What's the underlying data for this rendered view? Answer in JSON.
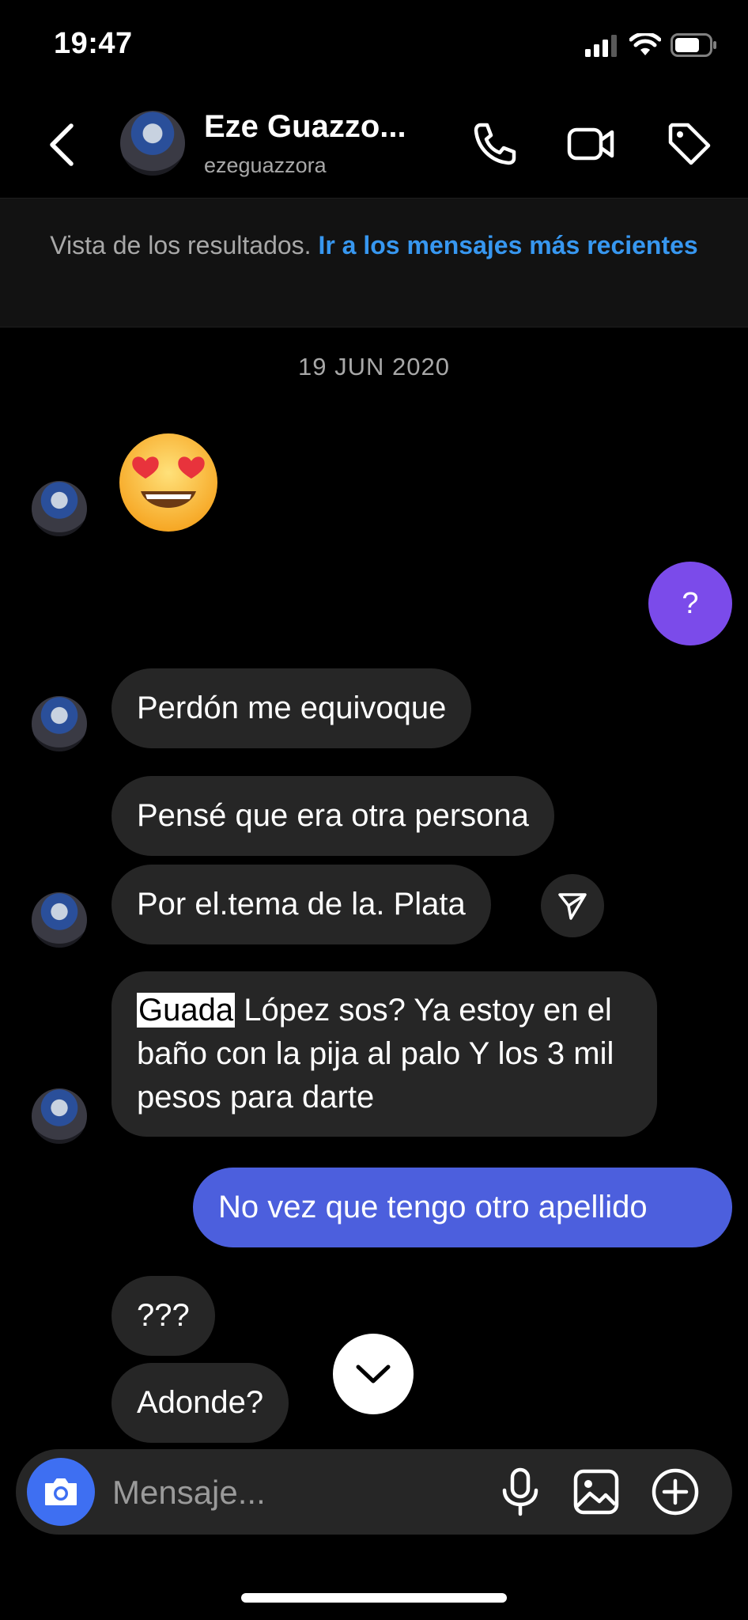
{
  "status_bar": {
    "time": "19:47"
  },
  "header": {
    "name": "Eze Guazzo...",
    "username": "ezeguazzora",
    "icons": [
      "back-chevron-icon",
      "phone-icon",
      "video-icon",
      "tag-icon"
    ]
  },
  "banner": {
    "text": "Vista de los resultados.",
    "link": "Ir a los mensajes más recientes"
  },
  "date_divider": "19 JUN 2020",
  "messages": [
    {
      "from": "them",
      "type": "emoji",
      "content": "heart-eyes"
    },
    {
      "from": "me",
      "text": "?"
    },
    {
      "from": "them",
      "text": "Perdón me equivoque"
    },
    {
      "from": "them",
      "text": "Pensé que era otra persona"
    },
    {
      "from": "them",
      "text": "Por el.tema de la. Plata"
    },
    {
      "from": "them",
      "highlight": "Guada",
      "text": " López sos? Ya estoy en el baño con la pija al palo Y los 3 mil pesos para darte"
    },
    {
      "from": "me",
      "text": "No vez que tengo otro apellido"
    },
    {
      "from": "them",
      "text": "???"
    },
    {
      "from": "them",
      "text": "Adonde?"
    }
  ],
  "composer": {
    "placeholder": "Mensaje..."
  },
  "colors": {
    "background": "#000000",
    "received_bubble": "#262626",
    "sent_bubble": "#4c5fdd",
    "question_bubble": "#7b4bea",
    "link": "#3797f0",
    "camera_button": "#3e6ff2"
  }
}
